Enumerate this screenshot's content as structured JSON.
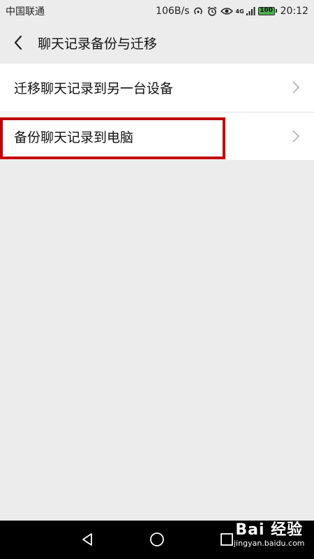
{
  "status_bar": {
    "carrier": "中国联通",
    "speed": "106B/s",
    "network": "4G",
    "battery": "100",
    "time": "20:12"
  },
  "header": {
    "title": "聊天记录备份与迁移"
  },
  "list": {
    "items": [
      {
        "label": "迁移聊天记录到另一台设备"
      },
      {
        "label": "备份聊天记录到电脑"
      }
    ]
  },
  "watermark": {
    "main": "Bai 经验",
    "sub": "jingyan.baidu.com"
  },
  "colors": {
    "background": "#ececec",
    "list_bg": "#ffffff",
    "highlight": "#c00000",
    "nav_bar": "#000000",
    "battery": "#4caf50"
  }
}
